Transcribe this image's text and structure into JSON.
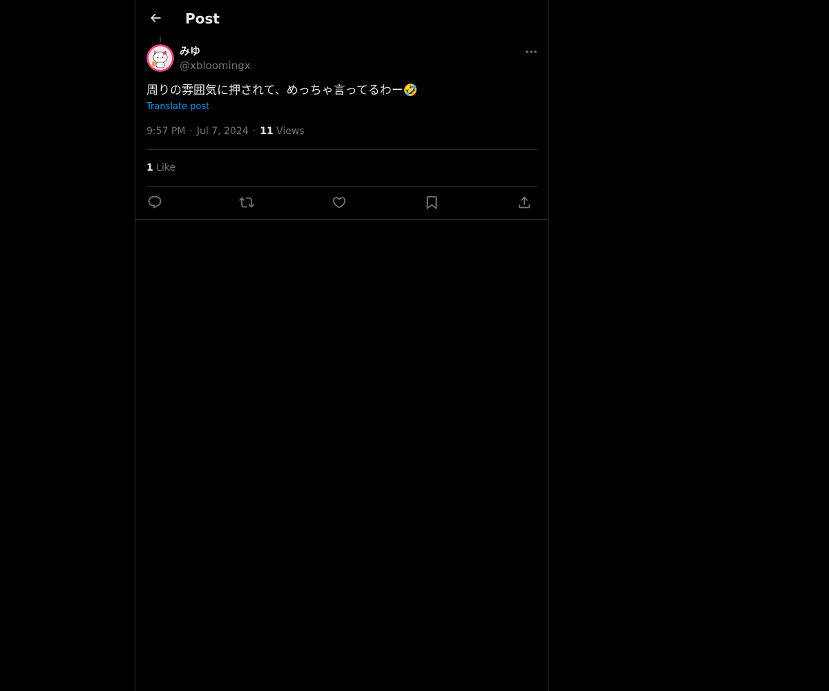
{
  "header": {
    "title": "Post",
    "back_icon": "arrow-left-icon"
  },
  "tweet": {
    "author": {
      "display_name": "みゆ",
      "handle": "@xbloomingx",
      "avatar_icon": "kitty-avatar"
    },
    "more_icon": "more-horizontal-icon",
    "text": "周りの雰囲気に押されて、めっちゃ言ってるわー🤣",
    "translate_label": "Translate post",
    "time": "9:57 PM",
    "date": "Jul 7, 2024",
    "views_count": "11",
    "views_label": "Views",
    "likes_count": "1",
    "likes_label": "Like"
  },
  "actions": {
    "reply_icon": "reply-icon",
    "retweet_icon": "retweet-icon",
    "like_icon": "heart-icon",
    "bookmark_icon": "bookmark-icon",
    "share_icon": "share-icon"
  },
  "colors": {
    "background": "#000000",
    "text": "#e7e9ea",
    "secondary": "#71767b",
    "link": "#1d9bf0",
    "border": "#2f3336"
  }
}
